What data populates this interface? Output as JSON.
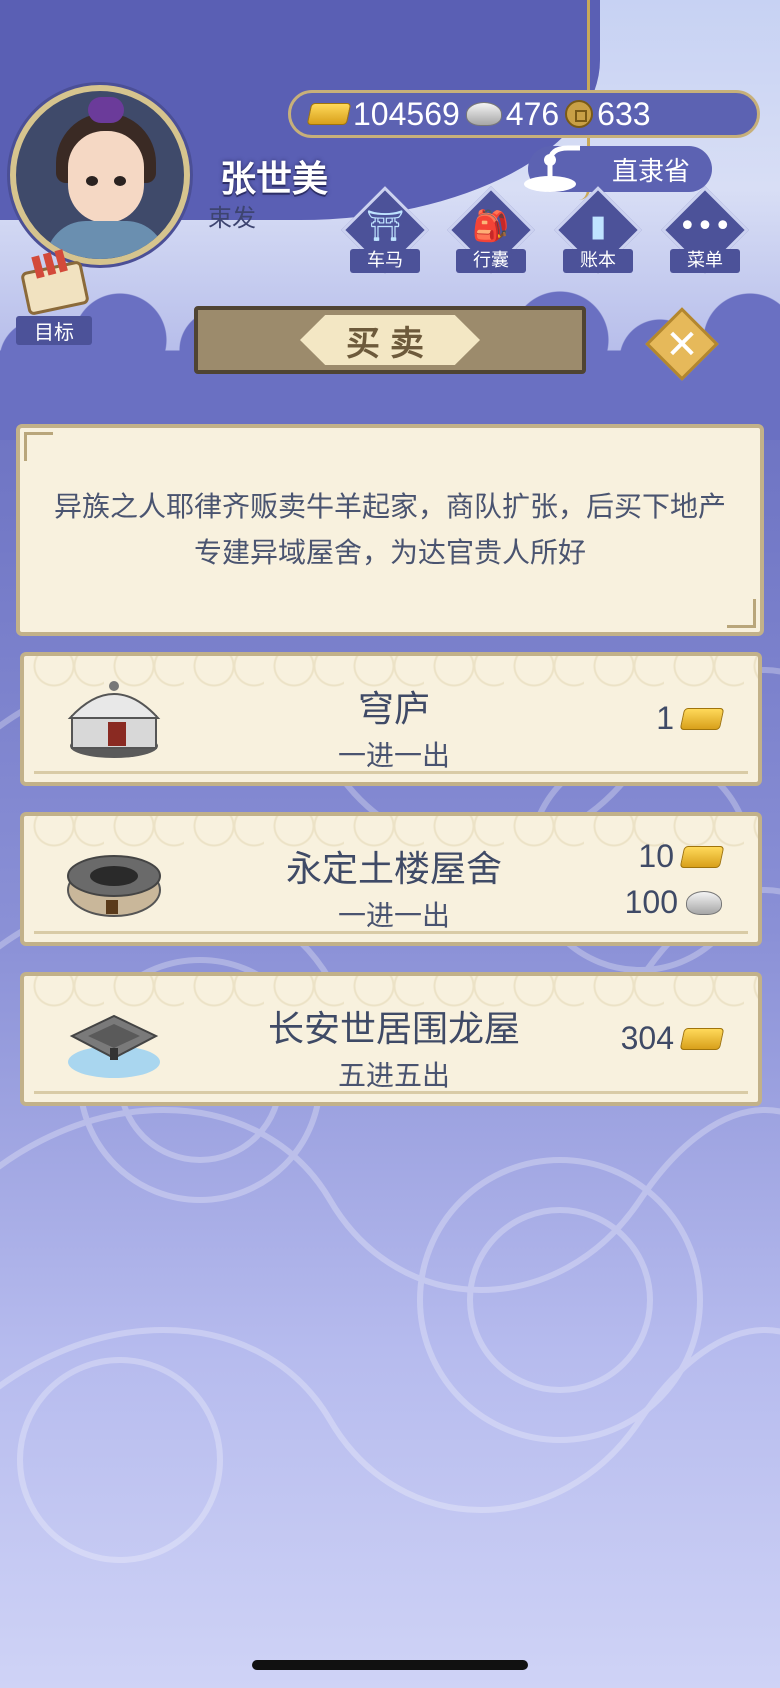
{
  "player": {
    "name": "张世美",
    "title": "束发"
  },
  "currency": {
    "gold": "104569",
    "silver": "476",
    "copper": "633"
  },
  "location": {
    "label": "直隶省"
  },
  "nav": [
    {
      "label": "车马",
      "icon": "carriage-icon"
    },
    {
      "label": "行囊",
      "icon": "bag-icon"
    },
    {
      "label": "账本",
      "icon": "ledger-icon"
    },
    {
      "label": "菜单",
      "icon": "menu-icon"
    }
  ],
  "target": {
    "label": "目标"
  },
  "panel": {
    "title": "买卖",
    "description": "异族之人耶律齐贩卖牛羊起家，商队扩张，后买下地产专建异域屋舍，为达官贵人所好"
  },
  "items": [
    {
      "name": "穹庐",
      "layout": "一进一出",
      "prices": [
        {
          "value": "1",
          "currency": "gold"
        }
      ]
    },
    {
      "name": "永定土楼屋舍",
      "layout": "一进一出",
      "prices": [
        {
          "value": "10",
          "currency": "gold"
        },
        {
          "value": "100",
          "currency": "silver"
        }
      ]
    },
    {
      "name": "长安世居围龙屋",
      "layout": "五进五出",
      "prices": [
        {
          "value": "304",
          "currency": "gold"
        }
      ]
    }
  ],
  "colors": {
    "panel_bg": "#f8f1de",
    "panel_border": "#c2b189",
    "primary_blue": "#5c62b2",
    "gold": "#e6b95a"
  }
}
